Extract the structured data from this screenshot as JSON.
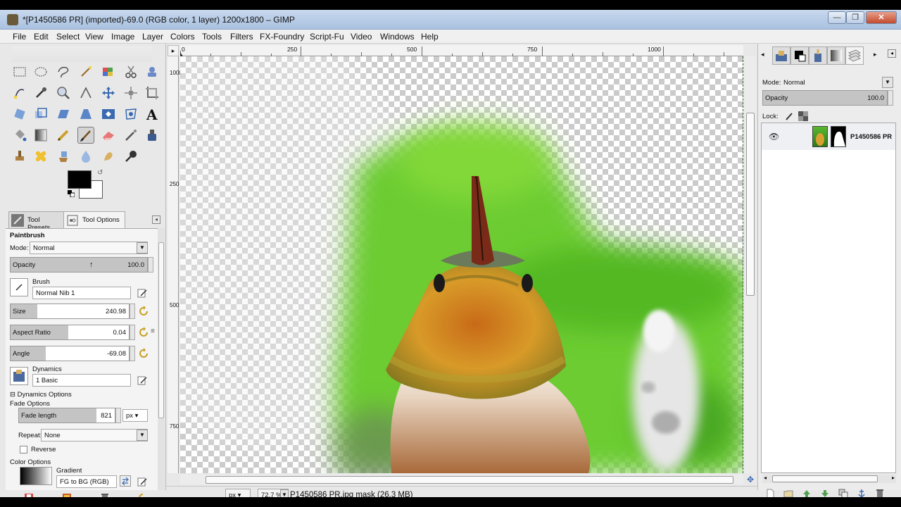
{
  "window": {
    "title": "*[P1450586 PR] (imported)-69.0 (RGB color, 1 layer) 1200x1800 – GIMP",
    "min_label": "—",
    "max_label": "❐",
    "close_label": "✕"
  },
  "menu": [
    "File",
    "Edit",
    "Select",
    "View",
    "Image",
    "Layer",
    "Colors",
    "Tools",
    "Filters",
    "FX-Foundry",
    "Script-Fu",
    "Video",
    "Windows",
    "Help"
  ],
  "toolbox": {
    "tabs": {
      "presets": "Tool Presets",
      "options": "Tool Options"
    },
    "tool_name": "Paintbrush",
    "mode_label": "Mode:",
    "mode_value": "Normal",
    "opacity_label": "Opacity",
    "opacity_value": "100.0",
    "brush_label": "Brush",
    "brush_value": "Normal Nib 1",
    "size_label": "Size",
    "size_value": "240.98",
    "aspect_label": "Aspect Ratio",
    "aspect_value": "0.04",
    "angle_label": "Angle",
    "angle_value": "-69.08",
    "dynamics_label": "Dynamics",
    "dynamics_value": "1 Basic",
    "dynamics_options": "Dynamics Options",
    "fade_options": "Fade Options",
    "fade_length_label": "Fade length",
    "fade_length_value": "821",
    "fade_unit": "px",
    "repeat_label": "Repeat:",
    "repeat_value": "None",
    "reverse_label": "Reverse",
    "color_options": "Color Options",
    "gradient_label": "Gradient",
    "gradient_value": "FG to BG (RGB)",
    "colors": {
      "fg": "#000000",
      "bg": "#ffffff"
    }
  },
  "ruler": {
    "h_labels": [
      "0",
      "250",
      "500",
      "750",
      "1000"
    ],
    "v_labels": [
      "250",
      "500",
      "750",
      "1000"
    ]
  },
  "status": {
    "unit": "px",
    "zoom": "72.7 %",
    "message": "P1450586 PR.jpg mask (26.3 MB)"
  },
  "layers": {
    "mode_label": "Mode:",
    "mode_value": "Normal",
    "opacity_label": "Opacity",
    "opacity_value": "100.0",
    "lock_label": "Lock:",
    "layer_name": "P1450586 PR"
  }
}
